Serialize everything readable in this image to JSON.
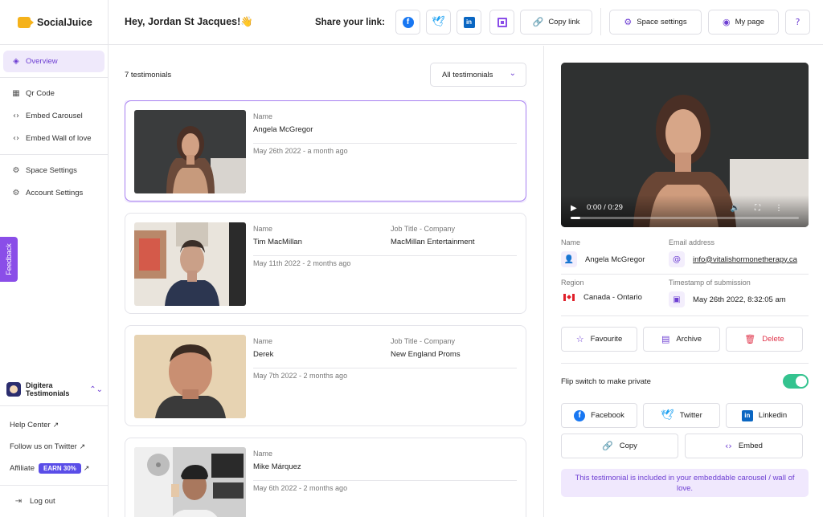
{
  "app": {
    "name": "SocialJuice"
  },
  "sidebar": {
    "items": [
      {
        "label": "Overview",
        "icon": "layers-icon"
      },
      {
        "label": "Qr Code",
        "icon": "qr-code-icon"
      },
      {
        "label": "Embed Carousel",
        "icon": "code-icon"
      },
      {
        "label": "Embed Wall of love",
        "icon": "code-icon"
      },
      {
        "label": "Space Settings",
        "icon": "gear-icon"
      },
      {
        "label": "Account Settings",
        "icon": "gear-icon"
      }
    ],
    "feedback_label": "Feedback",
    "space_name": "Digitera Testimonials",
    "help_center": "Help Center",
    "follow_twitter": "Follow us on Twitter",
    "affiliate": "Affiliate",
    "earn_badge": "EARN 30%",
    "logout": "Log out"
  },
  "header": {
    "greeting": "Hey, Jordan St Jacques!👋",
    "share_label": "Share your link:",
    "copy_link": "Copy link",
    "space_settings": "Space settings",
    "my_page": "My page"
  },
  "list": {
    "count_label": "7 testimonials",
    "filter_value": "All testimonials",
    "name_label": "Name",
    "job_label": "Job Title - Company",
    "cards": [
      {
        "name": "Angela McGregor",
        "job": "",
        "date": "May 26th 2022 - a month ago",
        "selected": true
      },
      {
        "name": "Tim MacMillan",
        "job": "MacMillan Entertainment",
        "date": "May 11th 2022 - 2 months ago",
        "selected": false
      },
      {
        "name": "Derek",
        "job": "New England Proms",
        "date": "May 7th 2022 - 2 months ago",
        "selected": false
      },
      {
        "name": "Mike Márquez",
        "job": "",
        "date": "May 6th 2022 - 2 months ago",
        "selected": false
      }
    ]
  },
  "detail": {
    "video_time": "0:00 / 0:29",
    "name_label": "Name",
    "name_value": "Angela McGregor",
    "email_label": "Email address",
    "email_value": "info@vitalishormonetherapy.ca",
    "region_label": "Region",
    "region_value": "Canada - Ontario",
    "timestamp_label": "Timestamp of submission",
    "timestamp_value": "May 26th 2022, 8:32:05 am",
    "favourite": "Favourite",
    "archive": "Archive",
    "delete": "Delete",
    "private_label": "Flip switch to make private",
    "private_on": true,
    "facebook": "Facebook",
    "twitter": "Twitter",
    "linkedin": "Linkedin",
    "copy": "Copy",
    "embed": "Embed",
    "note": "This testimonial is included in your embeddable carousel / wall of love."
  },
  "colors": {
    "accent": "#6e3fd3",
    "toggle_on": "#34c38f",
    "delete": "#e0344a",
    "logo": "#f5b21b"
  }
}
